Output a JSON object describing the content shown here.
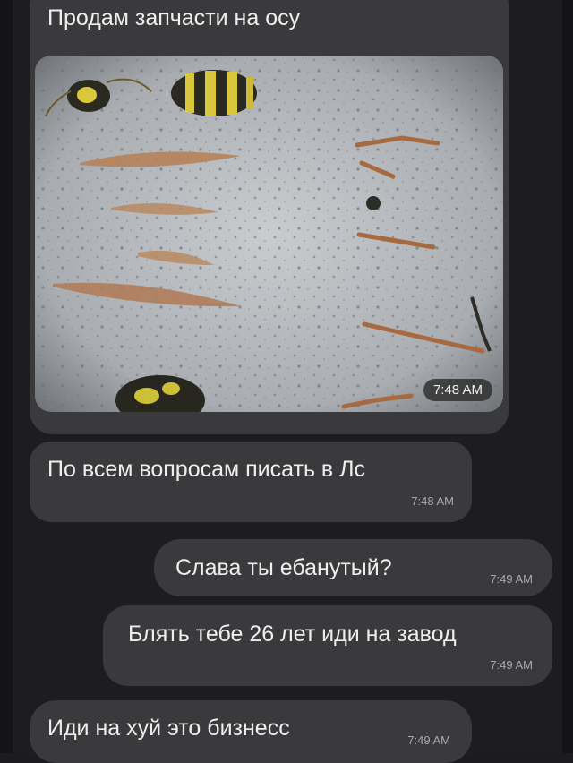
{
  "messages": [
    {
      "text": "Продам запчасти на осу",
      "time": "7:48 AM",
      "has_photo": true
    },
    {
      "text": "По всем вопросам писать в Лс",
      "time": "7:48 AM"
    },
    {
      "text": "Слава ты ебанутый?",
      "time": "7:49 AM"
    },
    {
      "text": "Блять тебе 26 лет иди на завод",
      "time": "7:49 AM"
    },
    {
      "text": "Иди на хуй это бизнесс",
      "time": "7:49 AM"
    }
  ],
  "colors": {
    "background": "#1d1d1f",
    "bubble": "#3a3a3c",
    "text": "#eeeeee",
    "timestamp": "#a9a9ab"
  }
}
